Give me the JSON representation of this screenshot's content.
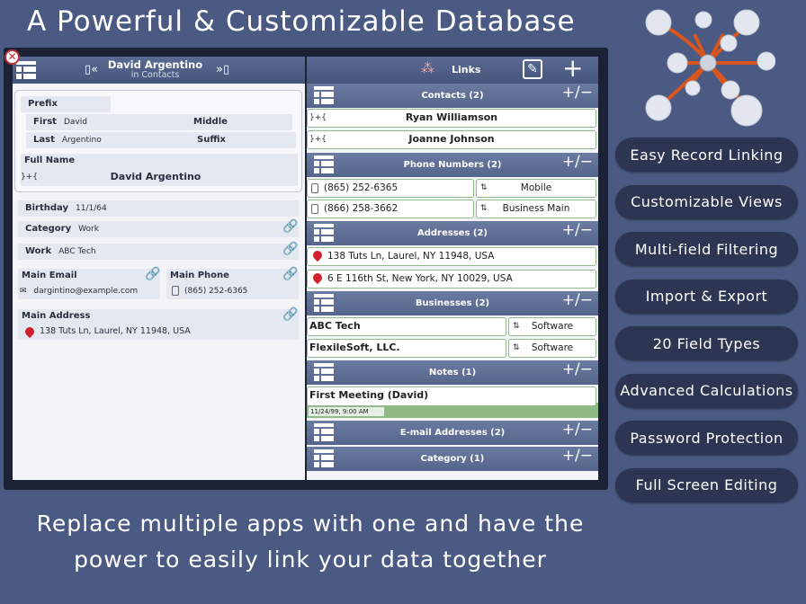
{
  "headline": "A Powerful & Customizable Database",
  "tagline_line1": "Replace multiple apps with one and have the",
  "tagline_line2": "power to easily link your data together",
  "features": [
    "Easy Record Linking",
    "Customizable Views",
    "Multi-field Filtering",
    "Import & Export",
    "20 Field Types",
    "Advanced Calculations",
    "Password Protection",
    "Full Screen Editing"
  ],
  "record": {
    "name": "David Argentino",
    "subtitle": "in Contacts",
    "prefix_label": "Prefix",
    "first_label": "First",
    "first_value": "David",
    "middle_label": "Middle",
    "last_label": "Last",
    "last_value": "Argentino",
    "suffix_label": "Suffix",
    "fullname_label": "Full Name",
    "fullname_value": "David Argentino",
    "birthday_label": "Birthday",
    "birthday_value": "11/1/64",
    "category_label": "Category",
    "category_value": "Work",
    "work_label": "Work",
    "work_value": "ABC Tech",
    "email_label": "Main Email",
    "email_value": "dargintino@example.com",
    "phone_label": "Main Phone",
    "phone_value": "(865) 252-6365",
    "address_label": "Main Address",
    "address_value": "138 Tuts Ln, Laurel, NY 11948, USA",
    "link_symbol": "}+{"
  },
  "links": {
    "title": "Links",
    "plus": "+",
    "plus_minus": "+/−",
    "contacts_header": "Contacts (2)",
    "contacts": [
      "Ryan Williamson",
      "Joanne Johnson"
    ],
    "phones_header": "Phone Numbers (2)",
    "phones": [
      {
        "number": "(865) 252-6365",
        "type": "Mobile"
      },
      {
        "number": "(866) 258-3662",
        "type": "Business Main"
      }
    ],
    "addresses_header": "Addresses (2)",
    "addresses": [
      "138 Tuts Ln, Laurel, NY 11948, USA",
      "6 E 116th St, New York, NY 10029, USA"
    ],
    "businesses_header": "Businesses (2)",
    "businesses": [
      {
        "name": "ABC Tech",
        "type": "Software"
      },
      {
        "name": "FlexileSoft, LLC.",
        "type": "Software"
      }
    ],
    "notes_header": "Notes (1)",
    "note_title": "First Meeting (David)",
    "note_date": "11/24/99, 9:00 AM",
    "emails_header": "E-mail Addresses (2)",
    "category_header": "Category (1)"
  },
  "colors": {
    "background": "#4a5a82",
    "pill": "#2c3653",
    "link_green": "#93b98d",
    "pin_red": "#d0202a"
  }
}
